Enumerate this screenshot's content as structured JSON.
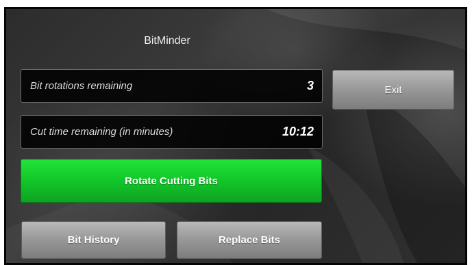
{
  "app": {
    "title": "BitMinder"
  },
  "readouts": {
    "rotations": {
      "label": "Bit rotations remaining",
      "value": "3"
    },
    "cut_time": {
      "label": "Cut time remaining (in minutes)",
      "value": "10:12"
    }
  },
  "buttons": {
    "exit": "Exit",
    "rotate": "Rotate Cutting Bits",
    "history": "Bit History",
    "replace": "Replace Bits"
  },
  "colors": {
    "accent_green": "#12c62a",
    "button_gray": "#9a9a9a",
    "readout_bg": "#000000"
  }
}
